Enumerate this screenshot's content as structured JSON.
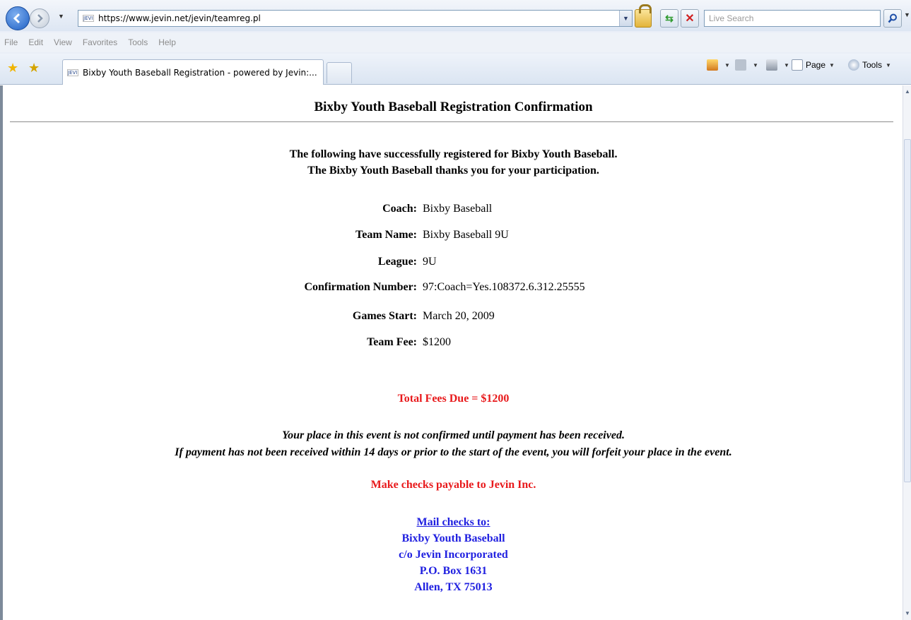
{
  "browser": {
    "url": "https://www.jevin.net/jevin/teamreg.pl",
    "favicon_text": "JEVIN",
    "search_placeholder": "Live Search",
    "menu": [
      "File",
      "Edit",
      "View",
      "Favorites",
      "Tools",
      "Help"
    ],
    "tab_title": "Bixby Youth Baseball Registration - powered by Jevin:...",
    "commands": {
      "page_label": "Page",
      "tools_label": "Tools"
    }
  },
  "page": {
    "title": "Bixby Youth Baseball Registration Confirmation",
    "intro_line1": "The following have successfully registered for Bixby Youth Baseball.",
    "intro_line2": "The Bixby Youth Baseball thanks you for your participation.",
    "fields": [
      {
        "label": "Coach:",
        "value": "Bixby Baseball"
      },
      {
        "label": "Team Name:",
        "value": "Bixby Baseball 9U"
      },
      {
        "label": "League:",
        "value": "9U"
      },
      {
        "label": "Confirmation Number:",
        "value": "97:Coach=Yes.108372.6.312.25555"
      },
      {
        "label": "Games Start:",
        "value": "March 20, 2009"
      },
      {
        "label": "Team Fee:",
        "value": "$1200"
      }
    ],
    "total": "Total Fees Due = $1200",
    "notice_line1": "Your place in this event is not confirmed until payment has been received.",
    "notice_line2": "If payment has not been received within 14 days or prior to the start of the event, you will forfeit your place in the event.",
    "checks_payable": "Make checks payable to Jevin Inc.",
    "mail": {
      "heading": "Mail checks to:",
      "line1": "Bixby Youth Baseball",
      "line2": "c/o Jevin Incorporated",
      "line3": "P.O. Box 1631",
      "line4": "Allen, TX 75013"
    }
  },
  "colors": {
    "total_red": "#e8191b",
    "mail_blue": "#1f1fe0"
  }
}
